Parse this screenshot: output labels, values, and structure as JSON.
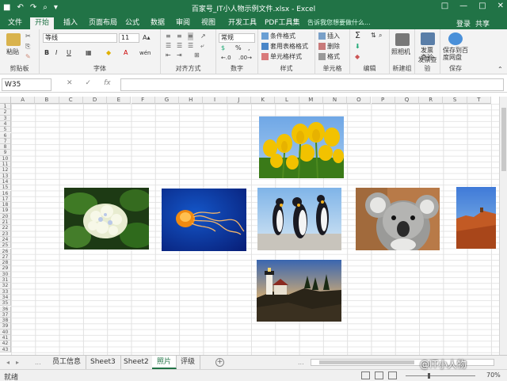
{
  "app": {
    "window_title": "百家号_IT小人物示例文件.xlsx - Excel",
    "qat": {
      "save": "■",
      "undo": "↶",
      "redo": "↷",
      "preview": "⌕",
      "more": "▾"
    },
    "window_buttons": {
      "ribbon_opts": "□",
      "minimize": "—",
      "maximize": "□",
      "close": "✕"
    }
  },
  "menu": {
    "tabs": [
      "文件",
      "开始",
      "插入",
      "页面布局",
      "公式",
      "数据",
      "审阅",
      "视图",
      "开发工具",
      "PDF工具集"
    ],
    "active": "开始",
    "tell_me": "告诉我您想要做什么...",
    "sign_in": "登录",
    "share": "共享"
  },
  "ribbon": {
    "clipboard": {
      "paste": "粘贴",
      "group": "剪贴板"
    },
    "font": {
      "name": "等线",
      "size": "11",
      "bold": "B",
      "italic": "I",
      "underline": "U",
      "wen": "wén",
      "group": "字体"
    },
    "alignment": {
      "group": "对齐方式"
    },
    "number": {
      "format": "常规",
      "percent": "%",
      "comma": ",",
      "group": "数字"
    },
    "styles": {
      "conditional": "条件格式",
      "table": "套用表格格式",
      "cell": "单元格样式",
      "group": "样式"
    },
    "cells": {
      "insert": "插入",
      "delete": "删除",
      "format": "格式",
      "group": "单元格"
    },
    "editing": {
      "sum": "Σ",
      "group": "编辑"
    },
    "newgroup": {
      "camera": "照相机",
      "group": "新建组"
    },
    "invoice": {
      "check": "发票查验",
      "group": "发票查验"
    },
    "save": {
      "save_baidu": "保存到百度网盘",
      "group": "保存"
    }
  },
  "formula_bar": {
    "name_box": "W35",
    "cancel": "✕",
    "enter": "✓",
    "fx": "fx",
    "formula": ""
  },
  "grid": {
    "columns": [
      "A",
      "B",
      "C",
      "D",
      "E",
      "F",
      "G",
      "H",
      "I",
      "J",
      "K",
      "L",
      "M",
      "N",
      "O",
      "P",
      "Q",
      "R",
      "S",
      "T"
    ],
    "row_count": 43
  },
  "photos": [
    {
      "id": "tulips",
      "subject": "tulips"
    },
    {
      "id": "hydrangea",
      "subject": "hydrangea"
    },
    {
      "id": "jellyfish",
      "subject": "jellyfish"
    },
    {
      "id": "penguins",
      "subject": "penguins"
    },
    {
      "id": "koala",
      "subject": "koala"
    },
    {
      "id": "desert",
      "subject": "desert"
    },
    {
      "id": "lighthouse",
      "subject": "lighthouse"
    }
  ],
  "sheets": {
    "tabs": [
      "员工信息",
      "Sheet3",
      "Sheet2",
      "照片",
      "评级"
    ],
    "active": "照片",
    "add": "+",
    "nav_prev": "◂",
    "nav_next": "▸",
    "nav_more": "..."
  },
  "status": {
    "text": "就绪",
    "zoom": "70%",
    "watermark": "@IT小人物"
  }
}
